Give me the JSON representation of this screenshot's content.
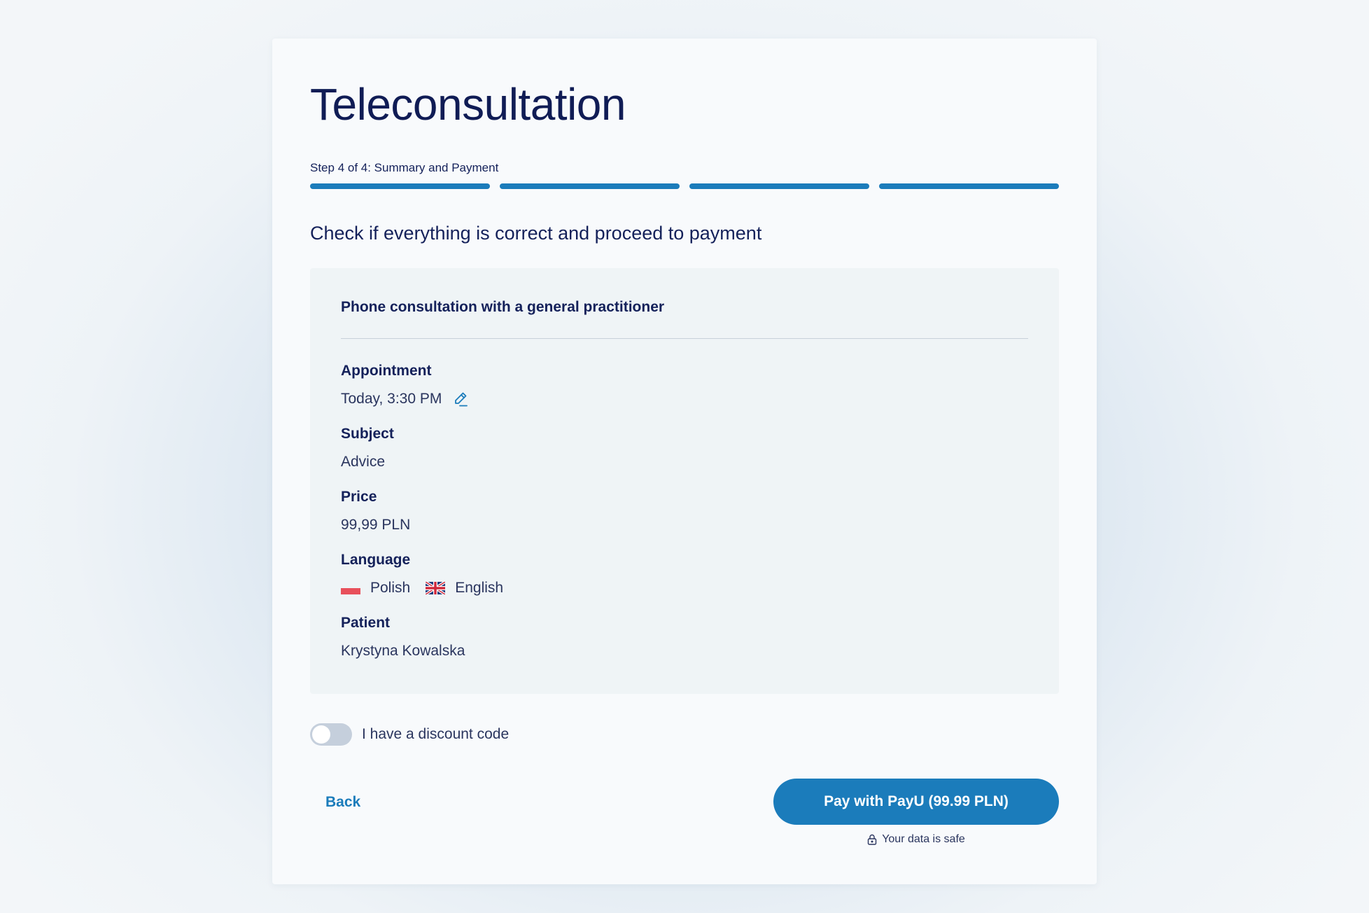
{
  "page": {
    "title": "Teleconsultation",
    "step_label": "Step 4 of 4: Summary and Payment",
    "progress": {
      "current_step": 4,
      "total_steps": 4
    },
    "heading": "Check if everything is correct and proceed to payment"
  },
  "summary": {
    "service": "Phone consultation with a general practitioner",
    "appointment": {
      "label": "Appointment",
      "value": "Today, 3:30 PM",
      "edit_icon": "pencil-icon"
    },
    "subject": {
      "label": "Subject",
      "value": "Advice"
    },
    "price": {
      "label": "Price",
      "value": "99,99 PLN"
    },
    "language": {
      "label": "Language",
      "options": [
        {
          "name": "Polish",
          "flag": "poland-flag"
        },
        {
          "name": "English",
          "flag": "uk-flag"
        }
      ]
    },
    "patient": {
      "label": "Patient",
      "value": "Krystyna Kowalska"
    }
  },
  "discount": {
    "label": "I have a discount code",
    "enabled": false
  },
  "actions": {
    "back_label": "Back",
    "pay_label": "Pay with PayU (99.99 PLN)",
    "safe_label": "Your data is safe"
  },
  "colors": {
    "accent": "#1b7cbb",
    "text": "#14215a",
    "card": "#f8fafc",
    "summary_bg": "#eff4f6",
    "toggle_off": "#c5cfdc"
  }
}
